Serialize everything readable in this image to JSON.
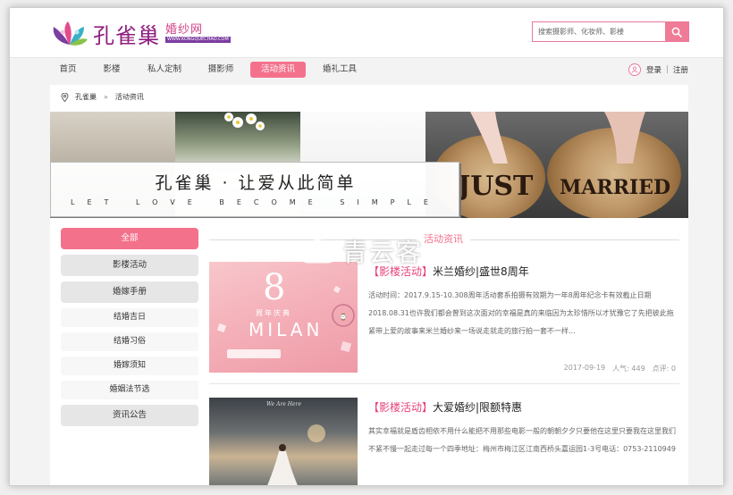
{
  "brand": {
    "name": "孔雀巢",
    "sub": "婚纱网",
    "domain": "WWW.KONGQUECHAO.COM",
    "accent": "#f4718c"
  },
  "search": {
    "placeholder": "搜索摄影师、化妆师、影楼"
  },
  "nav": {
    "items": [
      "首页",
      "影楼",
      "私人定制",
      "摄影师",
      "活动资讯",
      "婚礼工具"
    ],
    "active": "活动资讯"
  },
  "user": {
    "login": "登录",
    "sep": "|",
    "register": "注册"
  },
  "breadcrumb": {
    "home": "孔雀巢",
    "arrow": "»",
    "current": "活动资讯"
  },
  "banner": {
    "slogan": "孔雀巢 · 让爱从此简单",
    "slogan_en": "LET LOVE BECOME SIMPLE",
    "photo_text_1": "JUST",
    "photo_text_2": "MARRIED"
  },
  "sidebar": {
    "items": [
      {
        "label": "全部",
        "type": "main",
        "active": true
      },
      {
        "label": "影楼活动",
        "type": "main"
      },
      {
        "label": "婚嫁手册",
        "type": "main"
      },
      {
        "label": "结婚吉日",
        "type": "sub"
      },
      {
        "label": "结婚习俗",
        "type": "sub"
      },
      {
        "label": "婚嫁须知",
        "type": "sub"
      },
      {
        "label": "婚姻法节选",
        "type": "sub"
      },
      {
        "label": "资讯公告",
        "type": "main"
      }
    ]
  },
  "section": {
    "title": "活动资讯"
  },
  "articles": [
    {
      "tag": "【影楼活动】",
      "title": "米兰婚纱|盛世8周年",
      "desc": "活动时间：2017.9.15-10.308周年活动套系拍摄有效期为一年8周年纪念卡有效截止日期2018.08.31也许我们都会曾到这次面对的幸福是真的来临因为太珍惜所以才犹豫它了先把彼此拖紧带上爱的故事来米兰婚纱来一场说走就走的旅行拍一套不一样...",
      "date": "2017-09-19",
      "views": "人气: 449",
      "comments": "点评: 0",
      "image_text_big": "8",
      "image_text_sub": "周年庆典",
      "image_text_brand": "MILAN"
    },
    {
      "tag": "【影楼活动】",
      "title": "大爱婚纱|限额特惠",
      "desc": "其实幸福就是盾齿相依不用什么能把不用那些电影一般的朝朝夕夕只要他在这里只要我在这里我们不紧不慢一起走过每一个四季地址：梅州市梅江区江南西桥头嘉运园1-3号电话：0753-2110949",
      "image_text": "We Are Here"
    }
  ],
  "watermark": {
    "text": "青云客"
  }
}
